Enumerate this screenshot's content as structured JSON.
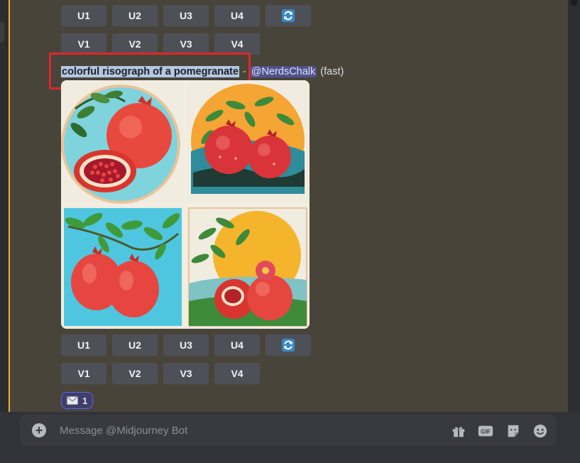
{
  "top_buttons": {
    "upscale": [
      "U1",
      "U2",
      "U3",
      "U4"
    ],
    "variation": [
      "V1",
      "V2",
      "V3",
      "V4"
    ],
    "reroll_icon": "refresh-icon"
  },
  "message": {
    "prompt": "colorful risograph of a pomegranate",
    "separator": "-",
    "mention": "@NerdsChalk",
    "speed": "(fast)"
  },
  "image_grid": {
    "tiles": [
      "pomegranate-tile-1",
      "pomegranate-tile-2",
      "pomegranate-tile-3",
      "pomegranate-tile-4"
    ]
  },
  "bottom_buttons": {
    "upscale": [
      "U1",
      "U2",
      "U3",
      "U4"
    ],
    "variation": [
      "V1",
      "V2",
      "V3",
      "V4"
    ],
    "reroll_icon": "refresh-icon"
  },
  "reaction": {
    "icon": "envelope-icon",
    "count": "1"
  },
  "composer": {
    "placeholder": "Message @Midjourney Bot",
    "icons": [
      "plus-icon",
      "gift-icon",
      "gif-icon",
      "sticker-icon",
      "emoji-icon"
    ],
    "gif_label": "GIF"
  },
  "colors": {
    "message_bg": "#49443a",
    "button_bg": "#4e5058",
    "reroll_blue": "#5865f2",
    "highlight_red": "#e0262a",
    "mention_bg": "#5865f2"
  }
}
